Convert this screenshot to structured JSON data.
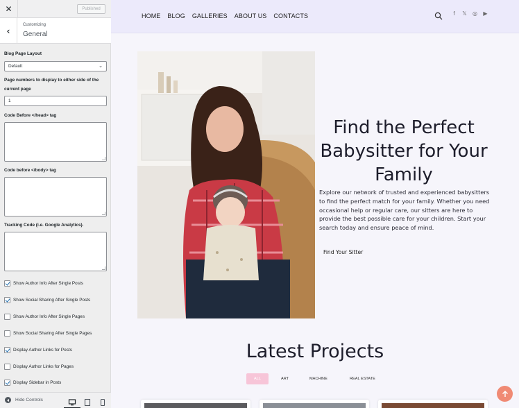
{
  "sidebar": {
    "close_label": "✕",
    "published_label": "Published",
    "back_label": "‹",
    "breadcrumb": "Customizing",
    "section_title": "General",
    "blog_layout_label": "Blog Page Layout",
    "blog_layout_value": "Default",
    "page_numbers_label": "Page numbers to display to either side of the current page",
    "page_numbers_value": "1",
    "code_head_label": "Code Before </head> tag",
    "code_body_label": "Code before </body> tag",
    "tracking_label": "Tracking Code (i.e. Google Analytics).",
    "checkboxes": [
      {
        "label": "Show Author Info After Single Posts",
        "checked": true
      },
      {
        "label": "Show Social Sharing After Single Posts",
        "checked": true
      },
      {
        "label": "Show Author Info After Single Pages",
        "checked": false
      },
      {
        "label": "Show Social Sharing After Single Pages",
        "checked": false
      },
      {
        "label": "Display Author Links for Posts",
        "checked": true
      },
      {
        "label": "Display Author Links for Pages",
        "checked": false
      },
      {
        "label": "Display Sidebar in Posts",
        "checked": true
      }
    ],
    "hide_controls_label": "Hide Controls",
    "devices": [
      "desktop-icon",
      "tablet-icon",
      "mobile-icon"
    ]
  },
  "site": {
    "nav": [
      "HOME",
      "BLOG",
      "GALLERIES",
      "ABOUT US",
      "CONTACTS"
    ],
    "social": [
      "f",
      "𝕏",
      "◎",
      "▶"
    ],
    "hero_title": "Find the Perfect Babysitter for Your Family",
    "hero_text": "Explore our network of trusted and experienced babysitters to find the perfect match for your family. Whether you need occasional help or regular care, our sitters are here to provide the best possible care for your children. Start your search today and ensure peace of mind.",
    "hero_button": "Find Your Sitter",
    "latest_title": "Latest Projects",
    "filters": [
      "ALL",
      "ART",
      "MACHINE",
      "REAL ESTATE"
    ],
    "accent_color": "#f08a74",
    "filter_active_color": "#f7c5d8"
  }
}
